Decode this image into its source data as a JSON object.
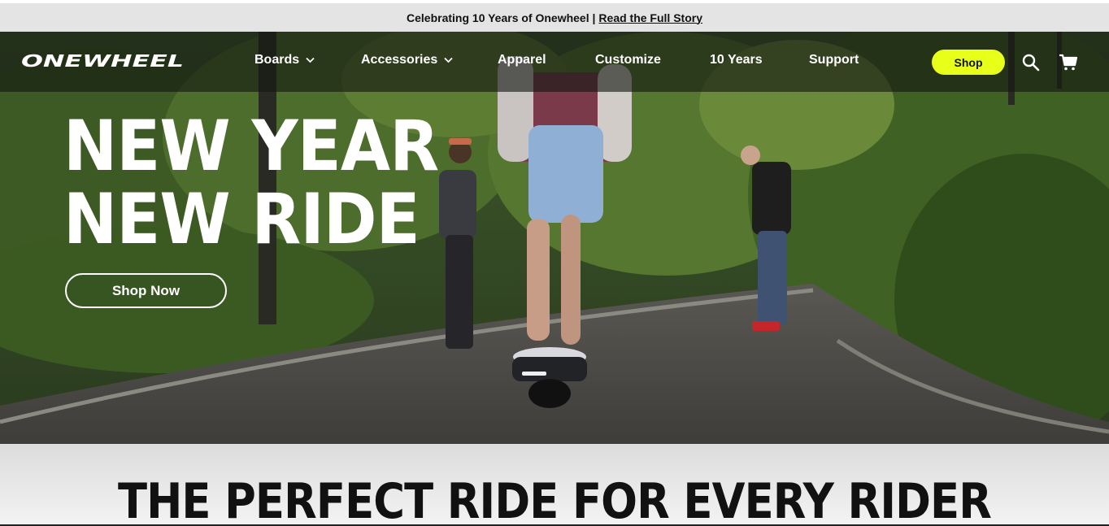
{
  "announcement": {
    "text": "Celebrating 10 Years of Onewheel |",
    "link_label": "Read the Full Story"
  },
  "header": {
    "logo_text": "ONEWHEEL",
    "nav": [
      {
        "label": "Boards",
        "has_dropdown": true
      },
      {
        "label": "Accessories",
        "has_dropdown": true
      },
      {
        "label": "Apparel",
        "has_dropdown": false
      },
      {
        "label": "Customize",
        "has_dropdown": false
      },
      {
        "label": "10 Years",
        "has_dropdown": false
      },
      {
        "label": "Support",
        "has_dropdown": false
      }
    ],
    "shop_label": "Shop",
    "icons": [
      "search-icon",
      "cart-icon"
    ]
  },
  "hero": {
    "headline_line1": "NEW YEAR",
    "headline_line2": "NEW RIDE",
    "cta_label": "Shop Now"
  },
  "section": {
    "title": "THE PERFECT RIDE FOR EVERY RIDER"
  },
  "colors": {
    "accent": "#e8ff1a",
    "announcement_bg": "#e4e4e4",
    "nav_overlay": "#141612"
  }
}
